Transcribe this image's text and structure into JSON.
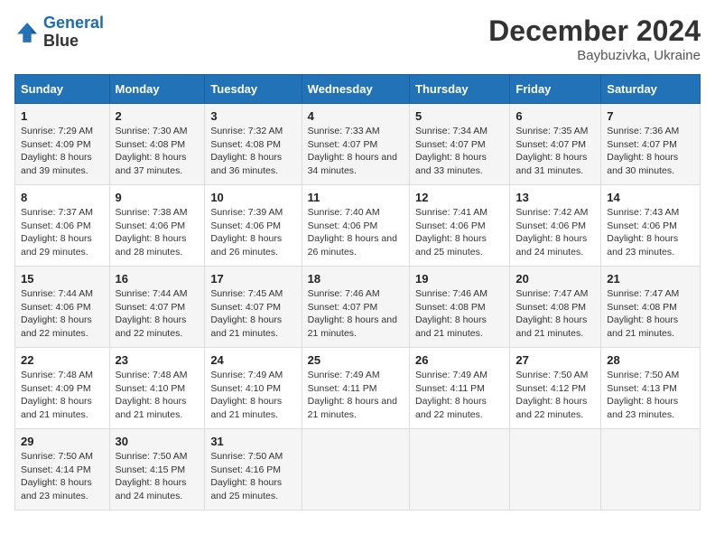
{
  "logo": {
    "line1": "General",
    "line2": "Blue"
  },
  "title": "December 2024",
  "location": "Baybuzivka, Ukraine",
  "days_header": [
    "Sunday",
    "Monday",
    "Tuesday",
    "Wednesday",
    "Thursday",
    "Friday",
    "Saturday"
  ],
  "weeks": [
    [
      {
        "day": "1",
        "sunrise": "7:29 AM",
        "sunset": "4:09 PM",
        "daylight": "8 hours and 39 minutes."
      },
      {
        "day": "2",
        "sunrise": "7:30 AM",
        "sunset": "4:08 PM",
        "daylight": "8 hours and 37 minutes."
      },
      {
        "day": "3",
        "sunrise": "7:32 AM",
        "sunset": "4:08 PM",
        "daylight": "8 hours and 36 minutes."
      },
      {
        "day": "4",
        "sunrise": "7:33 AM",
        "sunset": "4:07 PM",
        "daylight": "8 hours and 34 minutes."
      },
      {
        "day": "5",
        "sunrise": "7:34 AM",
        "sunset": "4:07 PM",
        "daylight": "8 hours and 33 minutes."
      },
      {
        "day": "6",
        "sunrise": "7:35 AM",
        "sunset": "4:07 PM",
        "daylight": "8 hours and 31 minutes."
      },
      {
        "day": "7",
        "sunrise": "7:36 AM",
        "sunset": "4:07 PM",
        "daylight": "8 hours and 30 minutes."
      }
    ],
    [
      {
        "day": "8",
        "sunrise": "7:37 AM",
        "sunset": "4:06 PM",
        "daylight": "8 hours and 29 minutes."
      },
      {
        "day": "9",
        "sunrise": "7:38 AM",
        "sunset": "4:06 PM",
        "daylight": "8 hours and 28 minutes."
      },
      {
        "day": "10",
        "sunrise": "7:39 AM",
        "sunset": "4:06 PM",
        "daylight": "8 hours and 26 minutes."
      },
      {
        "day": "11",
        "sunrise": "7:40 AM",
        "sunset": "4:06 PM",
        "daylight": "8 hours and 26 minutes."
      },
      {
        "day": "12",
        "sunrise": "7:41 AM",
        "sunset": "4:06 PM",
        "daylight": "8 hours and 25 minutes."
      },
      {
        "day": "13",
        "sunrise": "7:42 AM",
        "sunset": "4:06 PM",
        "daylight": "8 hours and 24 minutes."
      },
      {
        "day": "14",
        "sunrise": "7:43 AM",
        "sunset": "4:06 PM",
        "daylight": "8 hours and 23 minutes."
      }
    ],
    [
      {
        "day": "15",
        "sunrise": "7:44 AM",
        "sunset": "4:06 PM",
        "daylight": "8 hours and 22 minutes."
      },
      {
        "day": "16",
        "sunrise": "7:44 AM",
        "sunset": "4:07 PM",
        "daylight": "8 hours and 22 minutes."
      },
      {
        "day": "17",
        "sunrise": "7:45 AM",
        "sunset": "4:07 PM",
        "daylight": "8 hours and 21 minutes."
      },
      {
        "day": "18",
        "sunrise": "7:46 AM",
        "sunset": "4:07 PM",
        "daylight": "8 hours and 21 minutes."
      },
      {
        "day": "19",
        "sunrise": "7:46 AM",
        "sunset": "4:08 PM",
        "daylight": "8 hours and 21 minutes."
      },
      {
        "day": "20",
        "sunrise": "7:47 AM",
        "sunset": "4:08 PM",
        "daylight": "8 hours and 21 minutes."
      },
      {
        "day": "21",
        "sunrise": "7:47 AM",
        "sunset": "4:08 PM",
        "daylight": "8 hours and 21 minutes."
      }
    ],
    [
      {
        "day": "22",
        "sunrise": "7:48 AM",
        "sunset": "4:09 PM",
        "daylight": "8 hours and 21 minutes."
      },
      {
        "day": "23",
        "sunrise": "7:48 AM",
        "sunset": "4:10 PM",
        "daylight": "8 hours and 21 minutes."
      },
      {
        "day": "24",
        "sunrise": "7:49 AM",
        "sunset": "4:10 PM",
        "daylight": "8 hours and 21 minutes."
      },
      {
        "day": "25",
        "sunrise": "7:49 AM",
        "sunset": "4:11 PM",
        "daylight": "8 hours and 21 minutes."
      },
      {
        "day": "26",
        "sunrise": "7:49 AM",
        "sunset": "4:11 PM",
        "daylight": "8 hours and 22 minutes."
      },
      {
        "day": "27",
        "sunrise": "7:50 AM",
        "sunset": "4:12 PM",
        "daylight": "8 hours and 22 minutes."
      },
      {
        "day": "28",
        "sunrise": "7:50 AM",
        "sunset": "4:13 PM",
        "daylight": "8 hours and 23 minutes."
      }
    ],
    [
      {
        "day": "29",
        "sunrise": "7:50 AM",
        "sunset": "4:14 PM",
        "daylight": "8 hours and 23 minutes."
      },
      {
        "day": "30",
        "sunrise": "7:50 AM",
        "sunset": "4:15 PM",
        "daylight": "8 hours and 24 minutes."
      },
      {
        "day": "31",
        "sunrise": "7:50 AM",
        "sunset": "4:16 PM",
        "daylight": "8 hours and 25 minutes."
      },
      null,
      null,
      null,
      null
    ]
  ],
  "labels": {
    "sunrise": "Sunrise:",
    "sunset": "Sunset:",
    "daylight": "Daylight:"
  },
  "colors": {
    "header_bg": "#2272b8",
    "odd_row": "#f5f5f5",
    "even_row": "#ffffff"
  }
}
